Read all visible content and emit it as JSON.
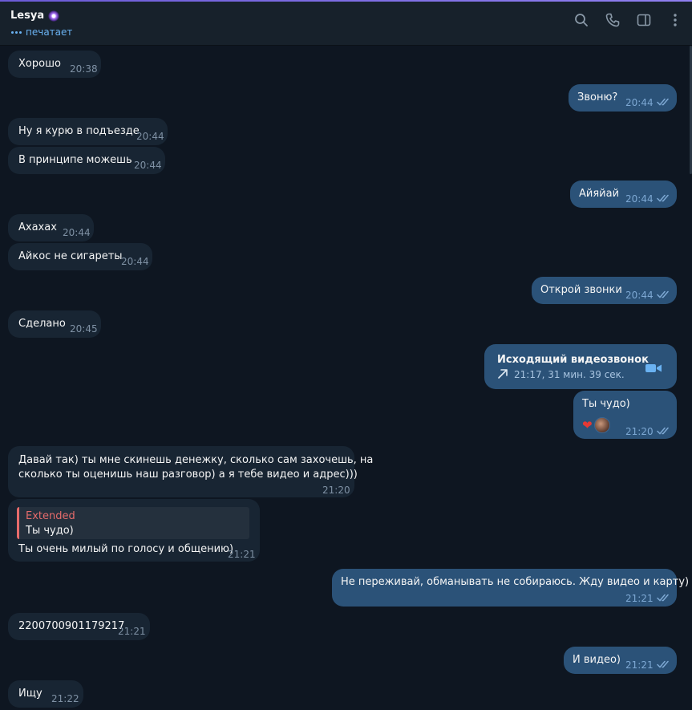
{
  "header": {
    "contact_name": "Lesya",
    "status": "печатает",
    "icons": [
      "search-icon",
      "phone-icon",
      "sidebar-toggle-icon",
      "more-icon"
    ]
  },
  "colors": {
    "background": "#0e1621",
    "incoming_bubble": "#182533",
    "outgoing_bubble": "#2b5278",
    "accent": "#6ab2f2",
    "reply_accent": "#e66b6b"
  },
  "messages": [
    {
      "dir": "in",
      "text": "Хорошо",
      "time": "20:38"
    },
    {
      "dir": "out",
      "text": "Звоню?",
      "time": "20:44",
      "read": true
    },
    {
      "dir": "in",
      "text": "Ну я курю в подъезде",
      "time": "20:44"
    },
    {
      "dir": "in",
      "text": "В принципе можешь",
      "time": "20:44"
    },
    {
      "dir": "out",
      "text": "Айяйай",
      "time": "20:44",
      "read": true
    },
    {
      "dir": "in",
      "text": "Ахахах",
      "time": "20:44"
    },
    {
      "dir": "in",
      "text": "Айкос не сигареты",
      "time": "20:44"
    },
    {
      "dir": "out",
      "text": "Открой звонки",
      "time": "20:44",
      "read": true
    },
    {
      "dir": "in",
      "text": "Сделано",
      "time": "20:45"
    },
    {
      "dir": "out",
      "type": "call",
      "title": "Исходящий видеозвонок",
      "detail": "21:17, 31 мин. 39 сек."
    },
    {
      "dir": "out",
      "text": "Ты чудо)",
      "time": "21:20",
      "read": true,
      "reactions": [
        "heart",
        "avatar"
      ]
    },
    {
      "dir": "in",
      "text_line1": "Давай так) ты мне скинешь денежку, сколько сам захочешь, на",
      "text_line2": "сколько ты оценишь наш разговор) а я тебе видео и адрес)))",
      "time": "21:20"
    },
    {
      "dir": "in",
      "reply_name": "Extended",
      "reply_text": "Ты чудо)",
      "text": "Ты очень милый по голосу и общению)",
      "time": "21:21"
    },
    {
      "dir": "out",
      "text": "Не переживай, обманывать не собираюсь. Жду видео и карту)",
      "time": "21:21",
      "read": true
    },
    {
      "dir": "in",
      "text": "2200700901179217",
      "time": "21:21"
    },
    {
      "dir": "out",
      "text": "И видео)",
      "time": "21:21",
      "read": true
    },
    {
      "dir": "in",
      "text": "Ищу",
      "time": "21:22"
    }
  ]
}
